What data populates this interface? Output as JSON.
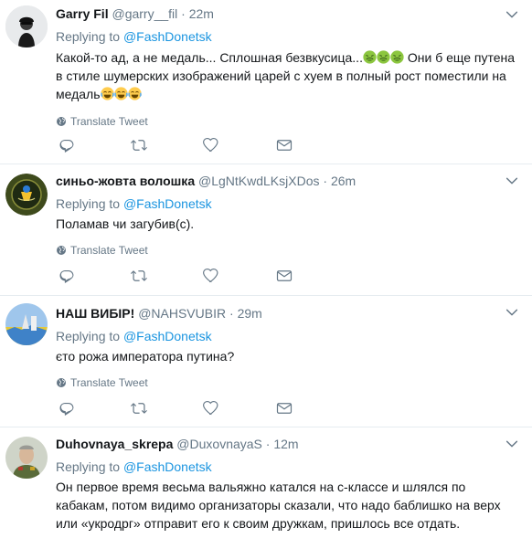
{
  "tweets": [
    {
      "name": "Garry Fil",
      "handle": "@garry__fil",
      "separator": "·",
      "time": "22m",
      "reply_prefix": "Replying to",
      "reply_to": "@FashDonetsk",
      "text_part1": "Какой-то ад, а не медаль... Сплошная безвкусица...",
      "text_part2": " Они б еще путена в стиле шумерских изображений царей с хуем в полный рост поместили на медаль",
      "emojis_1": [
        "nauseated-face",
        "nauseated-face",
        "nauseated-face"
      ],
      "emojis_2": [
        "tears-of-joy",
        "tears-of-joy",
        "tears-of-joy"
      ],
      "translate_label": "Translate Tweet"
    },
    {
      "name": "синьо-жовта волошка",
      "handle": "@LgNtKwdLKsjXDos",
      "separator": "·",
      "time": "26m",
      "reply_prefix": "Replying to",
      "reply_to": "@FashDonetsk",
      "text": "Поламав чи загубив(с).",
      "translate_label": "Translate Tweet"
    },
    {
      "name": "НАШ ВИБІР!",
      "handle": "@NAHSVUBIR",
      "separator": "·",
      "time": "29m",
      "reply_prefix": "Replying to",
      "reply_to": "@FashDonetsk",
      "text": "єто рожа императора путина?",
      "translate_label": "Translate Tweet"
    },
    {
      "name": "Duhovnaya_skrepa",
      "handle": "@DuxovnayaS",
      "separator": "·",
      "time": "12m",
      "reply_prefix": "Replying to",
      "reply_to": "@FashDonetsk",
      "text": "Он первое время весьма вальяжно катался на с-классе и шлялся по кабакам, потом видимо организаторы сказали,  что надо баблишко на верх или «укродрг» отправит его к своим дружкам, пришлось все отдать."
    }
  ],
  "colors": {
    "link": "#1b95e0",
    "secondary_text": "#657786",
    "primary_text": "#14171a",
    "icon": "#657786",
    "divider": "#e6ecf0"
  },
  "icons": [
    "globe-icon",
    "reply-icon",
    "retweet-icon",
    "like-icon",
    "dm-icon",
    "chevron-down-icon"
  ]
}
